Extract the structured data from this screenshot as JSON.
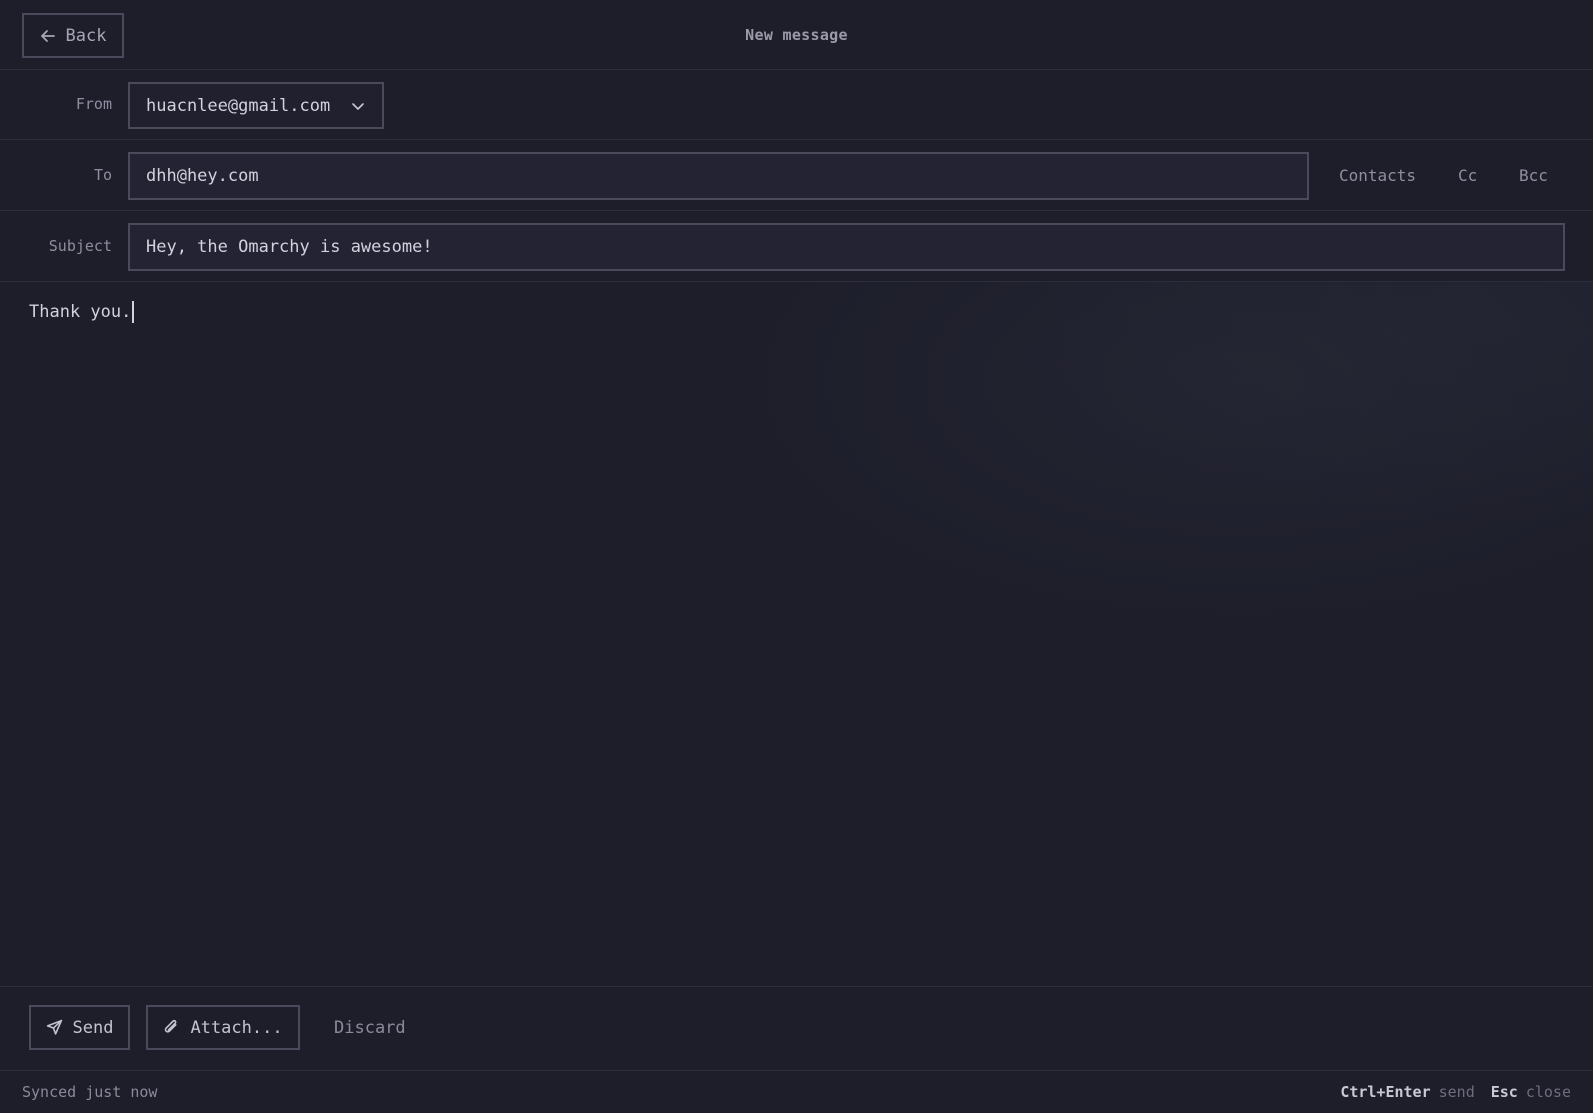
{
  "header": {
    "back_label": "Back",
    "title": "New message"
  },
  "from": {
    "label": "From",
    "value": "huacnlee@gmail.com"
  },
  "to": {
    "label": "To",
    "value": "dhh@hey.com",
    "contacts_label": "Contacts",
    "cc_label": "Cc",
    "bcc_label": "Bcc"
  },
  "subject": {
    "label": "Subject",
    "value": "Hey, the Omarchy is awesome!"
  },
  "body": {
    "text": "Thank you."
  },
  "actions": {
    "send_label": "Send",
    "attach_label": "Attach...",
    "discard_label": "Discard"
  },
  "status": {
    "sync_text": "Synced just now",
    "shortcuts": [
      {
        "key": "Ctrl+Enter",
        "desc": "send"
      },
      {
        "key": "Esc",
        "desc": "close"
      }
    ]
  },
  "colors": {
    "background": "#1e1e2b",
    "border": "#4a4a5c",
    "text": "#c9c9d6",
    "muted": "#8e8ea0"
  },
  "icons": {
    "back": "arrow-left-icon",
    "from_dropdown": "chevron-down-icon",
    "send": "paper-plane-icon",
    "attach": "paperclip-icon"
  }
}
